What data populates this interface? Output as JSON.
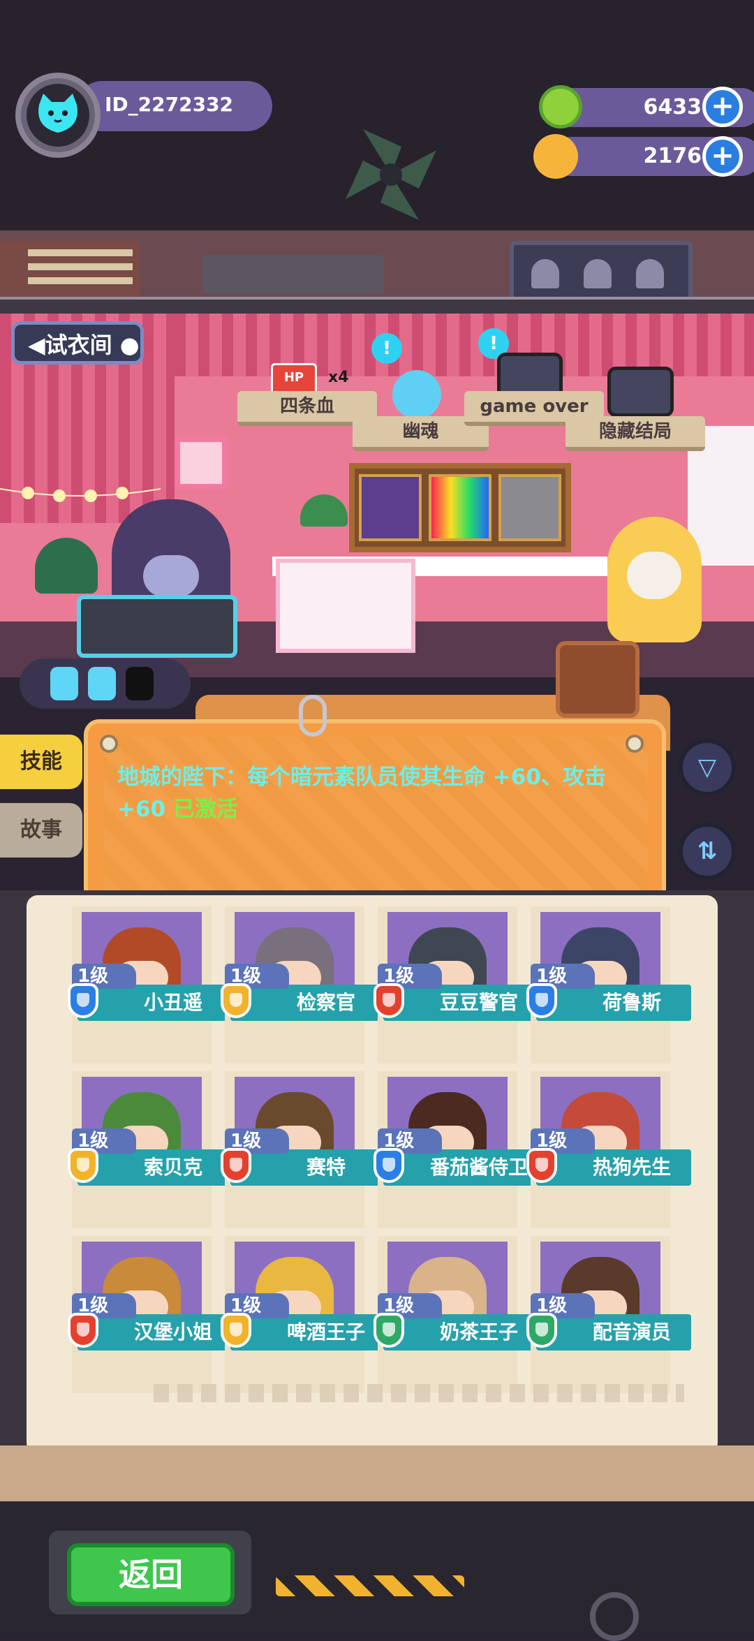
{
  "player": {
    "id": "ID_2272332"
  },
  "resources": [
    {
      "name": "green-gem",
      "value": "6433",
      "color": "#8fd13a"
    },
    {
      "name": "gold-planet",
      "value": "2176",
      "color": "#f6b53a"
    }
  ],
  "room": {
    "fitting_button": "试衣间",
    "tags": [
      {
        "label": "四条血",
        "badge": "x4"
      },
      {
        "label": "幽魂"
      },
      {
        "label": "game over"
      },
      {
        "label": "隐藏结局"
      }
    ],
    "notice_mark": "!"
  },
  "side_tabs": {
    "skill": "技能",
    "story": "故事"
  },
  "skill_panel": {
    "description": "地城的陛下：每个暗元素队员使其生命 +60、攻击 +60",
    "status": "已激活"
  },
  "colors": {
    "accent_cyan": "#6af0ea",
    "active_green": "#7cf04a",
    "panel_orange": "#f59b44",
    "name_bar": "#25a1ab"
  },
  "characters": [
    {
      "level": "1级",
      "name": "小丑遥",
      "badge_color": "#2b7ee6",
      "hair": "#b24a28"
    },
    {
      "level": "1级",
      "name": "检察官",
      "badge_color": "#f2b22a",
      "hair": "#7a6f7c"
    },
    {
      "level": "1级",
      "name": "豆豆警官",
      "badge_color": "#e4402e",
      "hair": "#3f4852"
    },
    {
      "level": "1级",
      "name": "荷鲁斯",
      "badge_color": "#2b7ee6",
      "hair": "#3c4566"
    },
    {
      "level": "1级",
      "name": "索贝克",
      "badge_color": "#f2b22a",
      "hair": "#4b8a3a"
    },
    {
      "level": "1级",
      "name": "赛特",
      "badge_color": "#e4402e",
      "hair": "#6a4a2d"
    },
    {
      "level": "1级",
      "name": "番茄酱侍卫",
      "badge_color": "#2b7ee6",
      "hair": "#4b2a22"
    },
    {
      "level": "1级",
      "name": "热狗先生",
      "badge_color": "#e4402e",
      "hair": "#c44a3a"
    },
    {
      "level": "1级",
      "name": "汉堡小姐",
      "badge_color": "#e4402e",
      "hair": "#c98a3a"
    },
    {
      "level": "1级",
      "name": "啤酒王子",
      "badge_color": "#f2b22a",
      "hair": "#e8b840"
    },
    {
      "level": "1级",
      "name": "奶茶王子",
      "badge_color": "#2ea866",
      "hair": "#d9b48a"
    },
    {
      "level": "1级",
      "name": "配音演员",
      "badge_color": "#2ea866",
      "hair": "#5a3a2a"
    }
  ],
  "bottom": {
    "back_button": "返回"
  }
}
